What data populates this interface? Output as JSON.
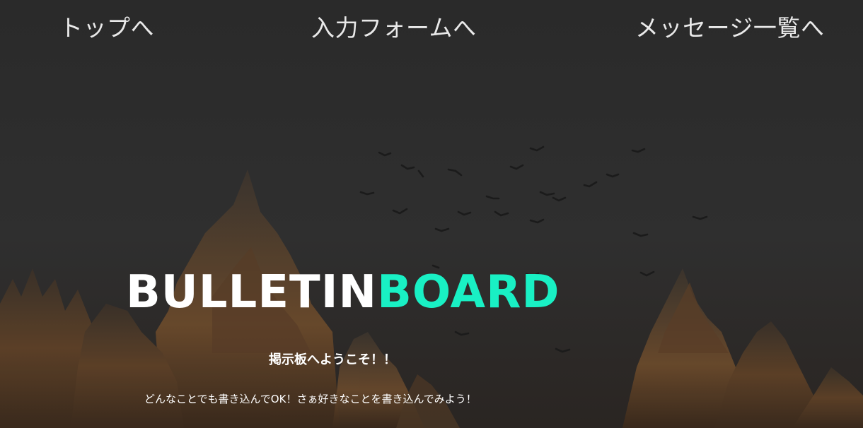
{
  "nav": {
    "top": "トップへ",
    "form": "入力フォームへ",
    "list": "メッセージ一覧へ"
  },
  "hero": {
    "title_part1": "BULLETIN",
    "title_part2": "BOARD",
    "welcome": "掲示板へようこそ！！",
    "description": "どんなことでも書き込んでOK！さぁ好きなことを書き込んでみよう！"
  },
  "colors": {
    "background": "#2c2c2c",
    "accent": "#19f0c4",
    "nav_text": "#e9e9e9",
    "trees": "#6b4a2c"
  },
  "background_image": {
    "subject": "forest-with-flying-birds"
  }
}
